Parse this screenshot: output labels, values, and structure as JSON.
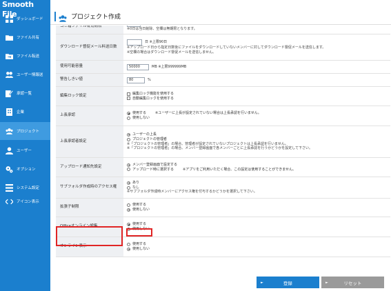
{
  "app": {
    "brand": "Smooth File"
  },
  "sidebar": {
    "items": [
      {
        "label": "ダッシュボード",
        "icon": "dashboard-icon"
      },
      {
        "label": "ファイル共有",
        "icon": "folder-icon"
      },
      {
        "label": "ファイル転送",
        "icon": "folder-send-icon"
      },
      {
        "label": "ユーザー情報送",
        "icon": "users-icon"
      },
      {
        "label": "承認一覧",
        "icon": "approval-icon"
      },
      {
        "label": "企業",
        "icon": "building-icon"
      },
      {
        "label": "プロジェクト",
        "icon": "project-icon"
      },
      {
        "label": "ユーザー",
        "icon": "user-icon"
      },
      {
        "label": "オプション",
        "icon": "gears-icon"
      },
      {
        "label": "システム設定",
        "icon": "system-icon"
      },
      {
        "label": "アイコン表示",
        "icon": "code-icon"
      }
    ],
    "active_index": 6
  },
  "header": {
    "title": "プロジェクト作成",
    "icon": "project-icon"
  },
  "form": {
    "trash_period": {
      "label": "ゴミ箱ファイル有効期限",
      "note": "※0日は当日削除、空欄は無期限となります。"
    },
    "download_reminder": {
      "label": "ダウンロード督促メール料送日数",
      "suffix": "日 ※上限90日",
      "note1": "※アップロード日から指定日数後にファイルをダウンロードしていないメンバーに対してダウンロード督促メールを送信します。",
      "note2": "※空欄の場合はダウンロード督促メールを送信しません。"
    },
    "capacity": {
      "label": "使用可能容量",
      "value": "50000",
      "suffix": "MB ※上限999999MB"
    },
    "warning": {
      "label": "警告しきい値",
      "value": "80",
      "suffix": "%"
    },
    "edit_lock": {
      "label": "編集ロック設定",
      "options": [
        "編集ロック機能を使用する",
        "自動編集ロックを使用する"
      ]
    },
    "approval": {
      "label": "上長承認",
      "options": [
        "使用する",
        "使用しない"
      ],
      "note": "※ユーザーに上長が設定されていない場合は上長承認を行いません。"
    },
    "approver_setting": {
      "label": "上長承認者設定",
      "options": [
        "ユーザーの上長",
        "プロジェクトの管理者"
      ],
      "note1": "※「プロジェクトの管理者」の場合、管理者が設定されていないプロジェクトは上長承認を行いません。",
      "note2": "※「プロジェクトの管理者」の場合、メンバー登録画面で各メンバーごとに上長承認を行うかどうかを設定して下さい。"
    },
    "upload_notify": {
      "label": "アップロード通知先設定",
      "options": [
        "メンバー登録画面で設定する",
        "アップロード時に選択する"
      ],
      "note": "※アプリをご利用いただく場合、この設定は使用することができません。"
    },
    "subfolder_access": {
      "label": "サブフォルダ作成時のアクセス権",
      "options": [
        "あり",
        "なし"
      ],
      "note": "※サブフォルダ作成時メンバーにアクセス権を付与するかどうかを選択して下さい。"
    },
    "extension_limit": {
      "label": "拡張子制限",
      "options": [
        "使用する",
        "使用しない"
      ]
    },
    "office_online": {
      "label": "Officeオンライン編集",
      "options": [
        "使用する",
        "使用しない"
      ]
    },
    "online_display": {
      "label": "オンライン表示",
      "options": [
        "使用する",
        "使用しない"
      ]
    }
  },
  "buttons": {
    "save": "登録",
    "reset": "リセット",
    "arrow": "►"
  },
  "colors": {
    "sidebar": "#1b7fce",
    "highlight": "#e02424",
    "reset": "#9a9a9a"
  }
}
